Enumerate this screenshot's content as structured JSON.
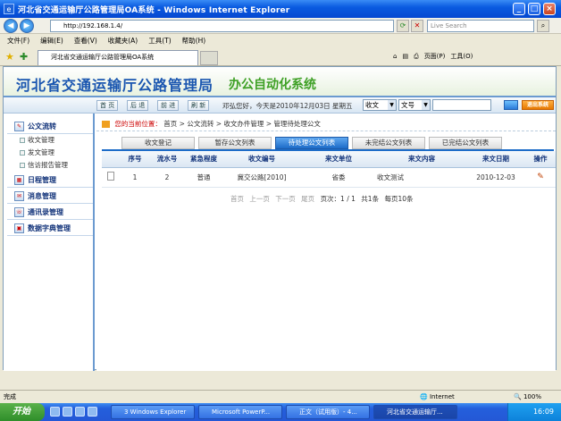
{
  "window": {
    "title": "河北省交通运输厅公路管理局OA系统 - Windows Internet Explorer",
    "minimize": "_",
    "maximize": "□",
    "close": "×"
  },
  "browser": {
    "back": "◀",
    "forward": "▶",
    "address": "http://192.168.1.4/",
    "search_placeholder": "Live Search",
    "menu": [
      "文件(F)",
      "编辑(E)",
      "查看(V)",
      "收藏夹(A)",
      "工具(T)",
      "帮助(H)"
    ],
    "tab_title": "河北省交通运输厅公路管理局OA系统",
    "page_menu": "页面(P)",
    "tools_menu": "工具(O)"
  },
  "banner": {
    "org": "河北省交通运输厅公路管理局",
    "system": "办公自动化系统"
  },
  "toolbar": {
    "home": "首 页",
    "back": "后 退",
    "forward": "前 进",
    "refresh": "刷 新",
    "greeting": "邓弘您好，今天是2010年12月03日 星期五",
    "filter1": "收文",
    "filter2": "文号",
    "logout": "退出系统"
  },
  "sidebar": {
    "groups": [
      {
        "label": "公文流转",
        "items": [
          "收文管理",
          "发文管理",
          "信访报告管理"
        ]
      },
      {
        "label": "日程管理"
      },
      {
        "label": "消息管理"
      },
      {
        "label": "通讯录管理"
      },
      {
        "label": "数据字典管理"
      }
    ]
  },
  "breadcrumb": {
    "here": "您的当前位置：",
    "path": "首页 > 公文流转 > 收文办件管理 > 管理待处理公文"
  },
  "tabs": [
    "收文登记",
    "暂存公文列表",
    "待处理公文列表",
    "未完结公文列表",
    "已完结公文列表"
  ],
  "table": {
    "headers": [
      "",
      "序号",
      "流水号",
      "紧急程度",
      "收文编号",
      "来文单位",
      "来文内容",
      "来文日期",
      "操作"
    ],
    "rows": [
      {
        "seq": "1",
        "serial": "2",
        "urgency": "普通",
        "number": "冀交公路[2010]",
        "unit": "省委",
        "content": "收文测试",
        "date": "2010-12-03"
      }
    ]
  },
  "pager": {
    "first": "首页",
    "prev": "上一页",
    "next": "下一页",
    "last": "尾页",
    "pages": "页次：1 / 1",
    "total": "共1条",
    "per_page": "每页10条"
  },
  "status": {
    "text": "完成",
    "zone": "Internet",
    "zoom": "100%"
  },
  "taskbar": {
    "start": "开始",
    "tasks": [
      "3 Windows Explorer",
      "Microsoft PowerP...",
      "正文（试用版）- 4...",
      "河北省交通运输厅..."
    ],
    "clock": "16:09"
  }
}
